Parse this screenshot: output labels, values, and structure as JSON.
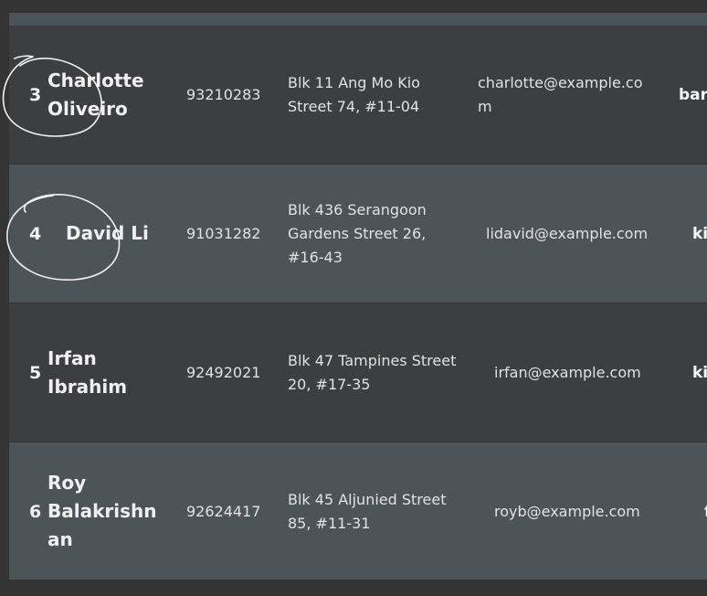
{
  "rows": [
    {
      "index": "3",
      "name_lines": [
        "Charlotte",
        "Oliveiro"
      ],
      "phone": "93210283",
      "address_lines": [
        "Blk 11 Ang Mo Kio",
        "Street 74, #11-04"
      ],
      "email_lines": [
        "charlotte@example.co",
        "m"
      ],
      "tag": "bar"
    },
    {
      "index": "4",
      "name_lines": [
        "David Li"
      ],
      "phone": "91031282",
      "address_lines": [
        "Blk 436 Serangoon",
        "Gardens Street 26,",
        "#16-43"
      ],
      "email_lines": [
        "lidavid@example.com"
      ],
      "tag": "ki"
    },
    {
      "index": "5",
      "name_lines": [
        "Irfan",
        "Ibrahim"
      ],
      "phone": "92492021",
      "address_lines": [
        "Blk 47 Tampines Street",
        "20, #17-35"
      ],
      "email_lines": [
        "irfan@example.com"
      ],
      "tag": "ki"
    },
    {
      "index": "6",
      "name_lines": [
        "Roy",
        "Balakrishn",
        "an"
      ],
      "phone": "92624417",
      "address_lines": [
        "Blk 45 Aljunied Street",
        "85, #11-31"
      ],
      "email_lines": [
        "royb@example.com"
      ],
      "tag": "f"
    }
  ]
}
